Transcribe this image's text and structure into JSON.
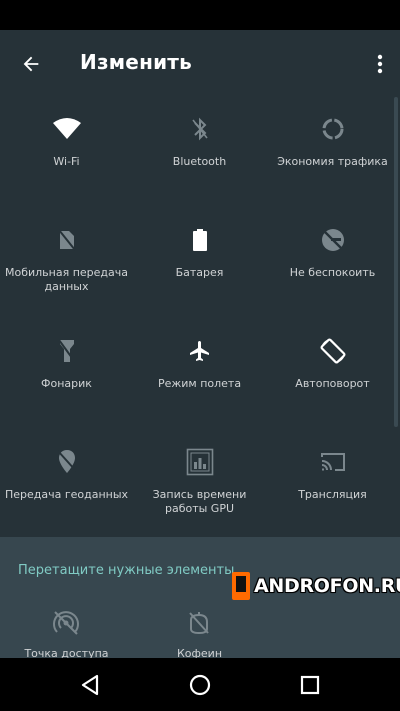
{
  "header": {
    "title": "Изменить"
  },
  "tiles": [
    {
      "label": "Wi-Fi",
      "icon": "wifi-icon"
    },
    {
      "label": "Bluetooth",
      "icon": "bluetooth-off-icon"
    },
    {
      "label": "Экономия трафика",
      "icon": "data-saver-icon"
    },
    {
      "label": "Мобильная передача данных",
      "icon": "mobile-data-off-icon"
    },
    {
      "label": "Батарея",
      "icon": "battery-icon"
    },
    {
      "label": "Не беспокоить",
      "icon": "dnd-off-icon"
    },
    {
      "label": "Фонарик",
      "icon": "flashlight-off-icon"
    },
    {
      "label": "Режим полета",
      "icon": "airplane-icon"
    },
    {
      "label": "Автоповорот",
      "icon": "auto-rotate-icon"
    },
    {
      "label": "Передача геоданных",
      "icon": "location-off-icon"
    },
    {
      "label": "Запись времени работы GPU",
      "icon": "gpu-profile-icon"
    },
    {
      "label": "Трансляция",
      "icon": "cast-icon"
    }
  ],
  "drag_section": {
    "header": "Перетащите нужные элементы",
    "items": [
      {
        "label": "Точка доступа",
        "icon": "hotspot-off-icon"
      },
      {
        "label": "Кофеин",
        "icon": "caffeine-off-icon"
      }
    ]
  },
  "watermark": {
    "text": "ANDROFON.RU"
  },
  "colors": {
    "background": "#263238",
    "drag_area": "#37474f",
    "accent": "#80cbc4",
    "icon_active": "#ffffff",
    "icon_inactive": "#7b878d"
  }
}
